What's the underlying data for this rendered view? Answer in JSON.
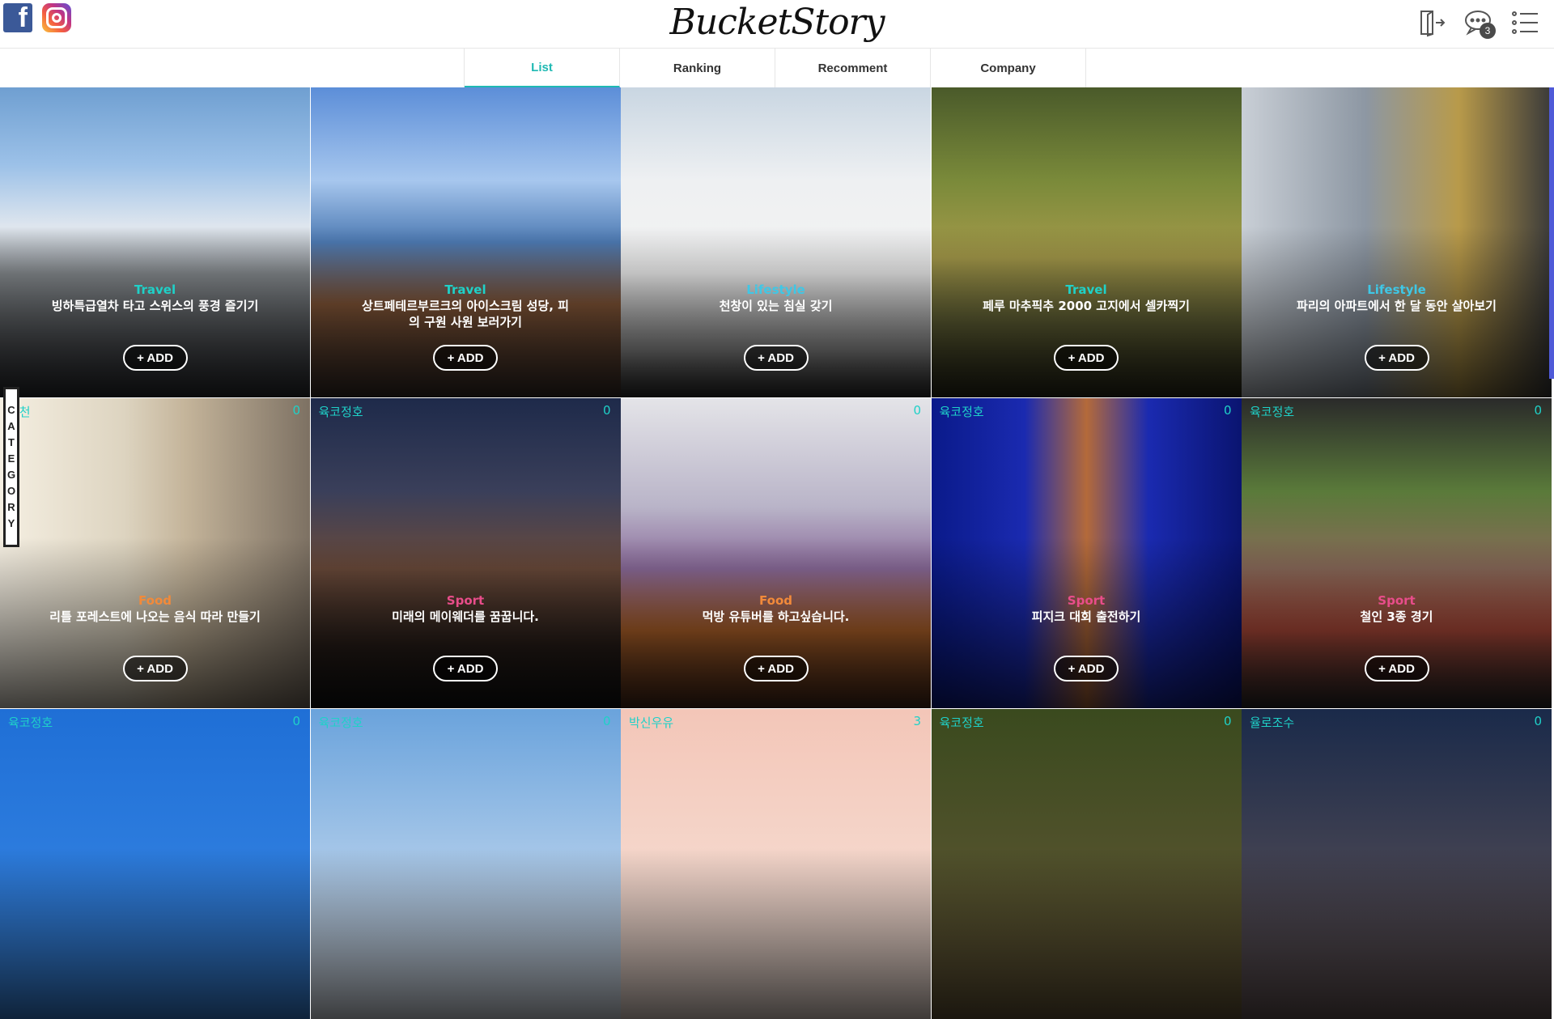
{
  "header": {
    "logo": "BucketStory",
    "message_badge": "3",
    "social": [
      "facebook-icon",
      "instagram-icon"
    ]
  },
  "tabs": [
    {
      "label": "List",
      "active": true
    },
    {
      "label": "Ranking",
      "active": false
    },
    {
      "label": "Recomment",
      "active": false
    },
    {
      "label": "Company",
      "active": false
    }
  ],
  "side_label": "CATEGORY",
  "add_label": "+ ADD",
  "colors": {
    "accent": "#1fb9b3",
    "travel": "#1fd1c8",
    "lifestyle": "#3fc7e6",
    "food": "#f28a3a",
    "sport": "#e84d8a"
  },
  "cards": [
    {
      "tag": "",
      "count": "",
      "category": "Travel",
      "title": "빙하특급열차 타고 스위스의 풍경 즐기기",
      "cat_color": "#1fd1c8",
      "bg": "linear-gradient(180deg,#6f9fd1 0%,#9cc1e8 25%,#dfe6ee 45%,#8a8f93 60%,#2b2d31 100%)"
    },
    {
      "tag": "",
      "count": "",
      "category": "Travel",
      "title": "상트페테르부르크의 아이스크림 성당, 피의 구원 사원 보러가기",
      "cat_color": "#1fd1c8",
      "bg": "linear-gradient(180deg,#5c8ed8 0%,#a7c7ee 30%,#4d7ab3 50%,#8b5b3a 70%,#3a2f2a 100%)"
    },
    {
      "tag": "",
      "count": "",
      "category": "Lifestyle",
      "title": "천창이 있는 침실 갖기",
      "cat_color": "#3fc7e6",
      "bg": "linear-gradient(180deg,#c9d6e2 0%,#eef0f2 30%,#f3f3f3 60%,#9a9a9a 85%,#2d2d2d 100%)"
    },
    {
      "tag": "",
      "count": "",
      "category": "Travel",
      "title": "페루 마추픽추 2000 고지에서 셀카찍기",
      "cat_color": "#1fd1c8",
      "bg": "linear-gradient(180deg,#4a5a2a 0%,#7a8a3a 30%,#a59a4a 55%,#6a6a3a 75%,#2a2a1a 100%)"
    },
    {
      "tag": "",
      "count": "",
      "category": "Lifestyle",
      "title": "파리의 아파트에서 한 달 동안 살아보기",
      "cat_color": "#3fc7e6",
      "bg": "linear-gradient(90deg,#c9cfd6 0%,#8d97a3 40%,#b89a4a 70%,#3a3a3a 100%)"
    },
    {
      "tag": "추천",
      "count": "0",
      "category": "Food",
      "title": "리틀 포레스트에 나오는 음식 따라 만들기",
      "cat_color": "#f28a3a",
      "bg": "linear-gradient(90deg,#f5efe2 0%,#ddd4c0 40%,#c4b49a 60%,#7d7163 100%)"
    },
    {
      "tag": "육코정호",
      "count": "0",
      "category": "Sport",
      "title": "미래의 메이웨더를 꿈꿉니다.",
      "cat_color": "#e84d8a",
      "bg": "linear-gradient(180deg,#1e2a4a 0%,#3a3f5a 30%,#6a4a3a 55%,#2a1f1a 80%,#111 100%)"
    },
    {
      "tag": "",
      "count": "0",
      "category": "Food",
      "title": "먹방 유튜버를 하고싶습니다.",
      "cat_color": "#f28a3a",
      "bg": "linear-gradient(180deg,#e4e4e8 0%,#b9b4c8 35%,#8a6a9a 55%,#b5652a 75%,#4a2a1a 100%)"
    },
    {
      "tag": "육코정호",
      "count": "0",
      "category": "Sport",
      "title": "피지크 대회 출전하기",
      "cat_color": "#e84d8a",
      "bg": "linear-gradient(90deg,#0a1a8a 0%,#1a2ab0 30%,#b46a3a 50%,#1a2ab0 70%,#0a1470 100%)"
    },
    {
      "tag": "육코정호",
      "count": "0",
      "category": "Sport",
      "title": "철인 3종 경기",
      "cat_color": "#e84d8a",
      "bg": "linear-gradient(180deg,#2a2a2a 0%,#5a7a3a 30%,#8a6a5a 55%,#b04a3a 75%,#2a2a2a 100%)"
    },
    {
      "tag": "육코정호",
      "count": "0",
      "category": "",
      "title": "",
      "cat_color": "#1fd1c8",
      "bg": "linear-gradient(180deg,#1f6fd6 0%,#3b8ae6 100%)"
    },
    {
      "tag": "육코정호",
      "count": "0",
      "category": "",
      "title": "",
      "cat_color": "#1fd1c8",
      "bg": "linear-gradient(180deg,#6aa3dc 0%,#e8eef6 100%)"
    },
    {
      "tag": "박신우유",
      "count": "3",
      "category": "",
      "title": "",
      "cat_color": "#1fd1c8",
      "bg": "linear-gradient(180deg,#f3c6b8 0%,#f7e7de 100%)"
    },
    {
      "tag": "육코정호",
      "count": "0",
      "category": "",
      "title": "",
      "cat_color": "#1fd1c8",
      "bg": "linear-gradient(180deg,#3a4a1e 0%,#6a5a3a 100%)"
    },
    {
      "tag": "율로조수",
      "count": "0",
      "category": "",
      "title": "",
      "cat_color": "#1fd1c8",
      "bg": "linear-gradient(180deg,#1a2a4a 0%,#6a5a5a 100%)"
    }
  ]
}
